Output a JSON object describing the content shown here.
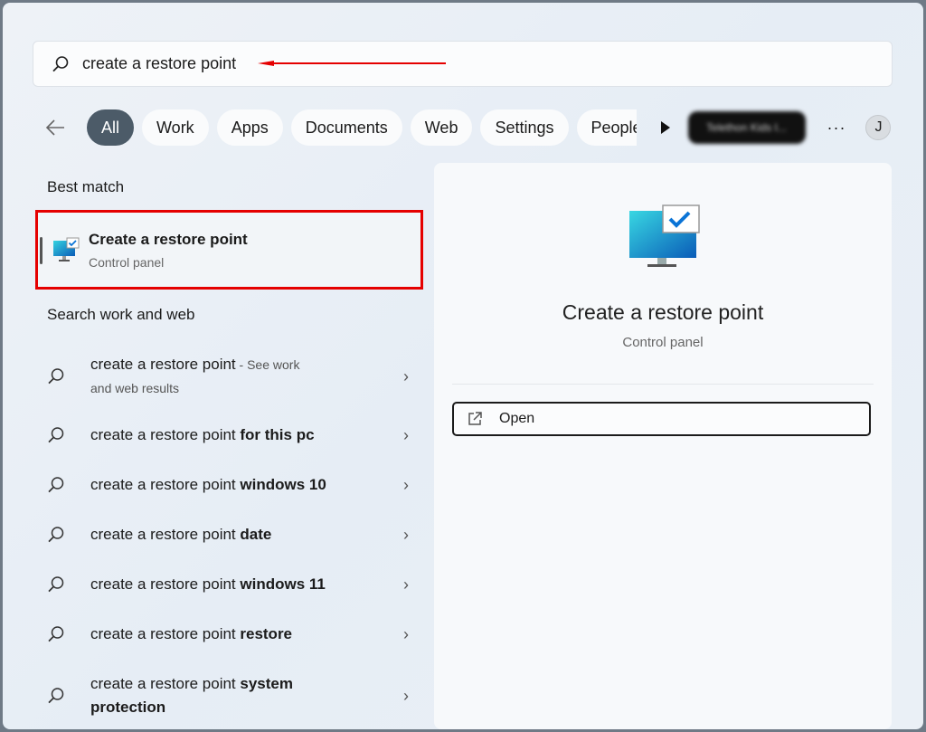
{
  "search": {
    "query": "create a restore point",
    "icon": "search-icon"
  },
  "annotation": {
    "color": "#e50000"
  },
  "filters": {
    "items": [
      "All",
      "Work",
      "Apps",
      "Documents",
      "Web",
      "Settings",
      "People"
    ],
    "active": "All",
    "account_chip": "Telethon Kids I...",
    "more": "···",
    "avatar_initial": "J"
  },
  "best_match": {
    "heading": "Best match",
    "title": "Create a restore point",
    "subtitle": "Control panel"
  },
  "web": {
    "heading": "Search work and web",
    "items": [
      {
        "prefix": "create a restore point",
        "bold": "",
        "suffix": " - See work",
        "sub": "and web results"
      },
      {
        "prefix": "create a restore point ",
        "bold": "for this pc"
      },
      {
        "prefix": "create a restore point ",
        "bold": "windows 10"
      },
      {
        "prefix": "create a restore point ",
        "bold": "date"
      },
      {
        "prefix": "create a restore point ",
        "bold": "windows 11"
      },
      {
        "prefix": "create a restore point ",
        "bold": "restore"
      },
      {
        "prefix": "create a restore point ",
        "bold": "system",
        "bold2": "protection"
      }
    ]
  },
  "preview": {
    "title": "Create a restore point",
    "subtitle": "Control panel",
    "open_label": "Open"
  }
}
